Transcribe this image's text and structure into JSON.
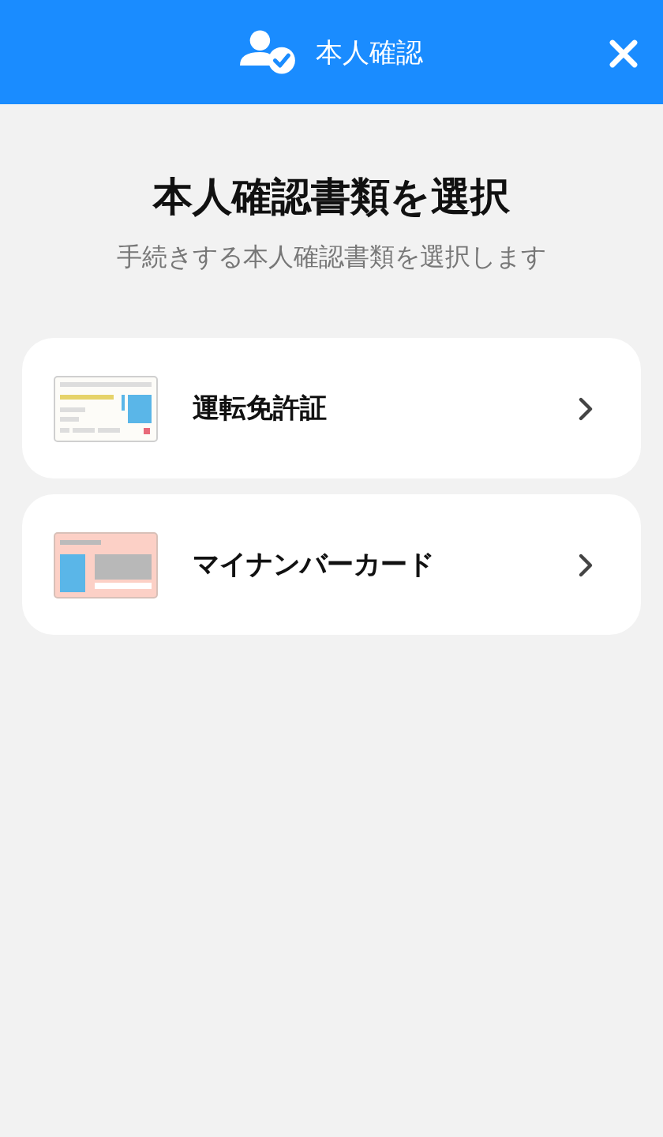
{
  "header": {
    "title": "本人確認"
  },
  "heading": "本人確認書類を選択",
  "subheading": "手続きする本人確認書類を選択します",
  "documents": [
    {
      "kind": "license",
      "label": "運転免許証"
    },
    {
      "kind": "mynumber",
      "label": "マイナンバーカード"
    }
  ]
}
